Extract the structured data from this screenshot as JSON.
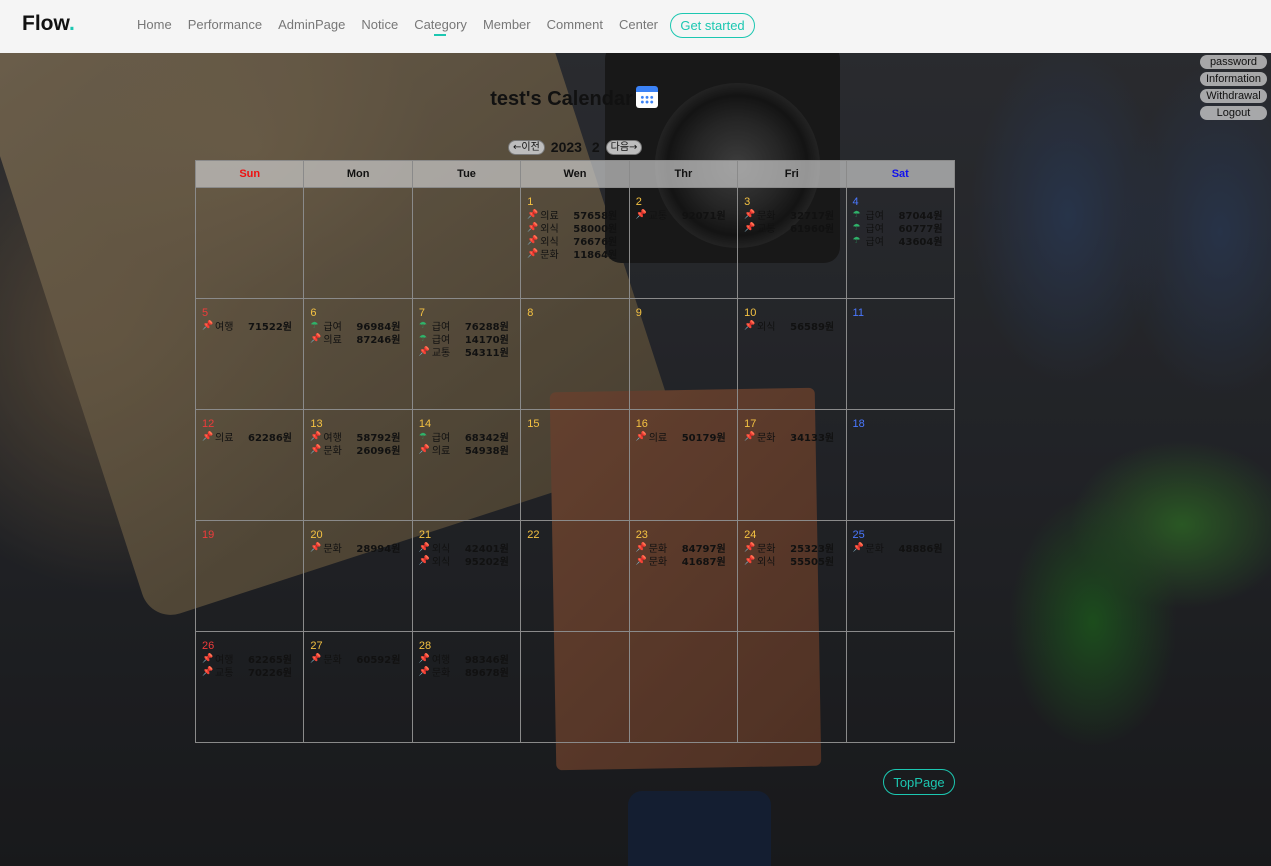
{
  "nav": {
    "logo": "Flow",
    "logo_dot": ".",
    "links": [
      "Home",
      "Performance",
      "AdminPage",
      "Notice",
      "Category",
      "Member",
      "Comment",
      "Center"
    ],
    "active": "Category",
    "cta": "Get started"
  },
  "user_menu": [
    "password",
    "Information",
    "Withdrawal",
    "Logout"
  ],
  "calendar": {
    "title": "test's Calendar",
    "prev_label": "←이전",
    "next_label": "다음→",
    "year": "2023",
    "month": "2",
    "weekdays": [
      "Sun",
      "Mon",
      "Tue",
      "Wen",
      "Thr",
      "Fri",
      "Sat"
    ],
    "weeks": [
      [
        null,
        null,
        null,
        {
          "day": "1",
          "entries": [
            {
              "type": "expense",
              "cat": "의료",
              "amount": "57658원"
            },
            {
              "type": "expense",
              "cat": "외식",
              "amount": "58000원"
            },
            {
              "type": "expense",
              "cat": "외식",
              "amount": "76676원"
            },
            {
              "type": "expense",
              "cat": "문화",
              "amount": "11864원"
            }
          ]
        },
        {
          "day": "2",
          "entries": [
            {
              "type": "expense",
              "cat": "교통",
              "amount": "92071원"
            }
          ]
        },
        {
          "day": "3",
          "entries": [
            {
              "type": "expense",
              "cat": "문화",
              "amount": "32717원"
            },
            {
              "type": "expense",
              "cat": "교통",
              "amount": "61960원"
            }
          ]
        },
        {
          "day": "4",
          "entries": [
            {
              "type": "income",
              "cat": "급여",
              "amount": "87044원"
            },
            {
              "type": "income",
              "cat": "급여",
              "amount": "60777원"
            },
            {
              "type": "income",
              "cat": "급여",
              "amount": "43604원"
            }
          ]
        }
      ],
      [
        {
          "day": "5",
          "entries": [
            {
              "type": "expense",
              "cat": "여행",
              "amount": "71522원"
            }
          ]
        },
        {
          "day": "6",
          "entries": [
            {
              "type": "income",
              "cat": "급여",
              "amount": "96984원"
            },
            {
              "type": "expense",
              "cat": "의료",
              "amount": "87246원"
            }
          ]
        },
        {
          "day": "7",
          "entries": [
            {
              "type": "income",
              "cat": "급여",
              "amount": "76288원"
            },
            {
              "type": "income",
              "cat": "급여",
              "amount": "14170원"
            },
            {
              "type": "expense",
              "cat": "교통",
              "amount": "54311원"
            }
          ]
        },
        {
          "day": "8",
          "entries": []
        },
        {
          "day": "9",
          "entries": []
        },
        {
          "day": "10",
          "entries": [
            {
              "type": "expense",
              "cat": "외식",
              "amount": "56589원"
            }
          ]
        },
        {
          "day": "11",
          "entries": []
        }
      ],
      [
        {
          "day": "12",
          "entries": [
            {
              "type": "expense",
              "cat": "의료",
              "amount": "62286원"
            }
          ]
        },
        {
          "day": "13",
          "entries": [
            {
              "type": "expense",
              "cat": "여행",
              "amount": "58792원"
            },
            {
              "type": "expense",
              "cat": "문화",
              "amount": "26096원"
            }
          ]
        },
        {
          "day": "14",
          "entries": [
            {
              "type": "income",
              "cat": "급여",
              "amount": "68342원"
            },
            {
              "type": "expense",
              "cat": "의료",
              "amount": "54938원"
            }
          ]
        },
        {
          "day": "15",
          "entries": []
        },
        {
          "day": "16",
          "entries": [
            {
              "type": "expense",
              "cat": "의료",
              "amount": "50179원"
            }
          ]
        },
        {
          "day": "17",
          "entries": [
            {
              "type": "expense",
              "cat": "문화",
              "amount": "34133원"
            }
          ]
        },
        {
          "day": "18",
          "entries": []
        }
      ],
      [
        {
          "day": "19",
          "entries": []
        },
        {
          "day": "20",
          "entries": [
            {
              "type": "expense",
              "cat": "문화",
              "amount": "28994원"
            }
          ]
        },
        {
          "day": "21",
          "entries": [
            {
              "type": "expense",
              "cat": "외식",
              "amount": "42401원"
            },
            {
              "type": "expense",
              "cat": "외식",
              "amount": "95202원"
            }
          ]
        },
        {
          "day": "22",
          "entries": []
        },
        {
          "day": "23",
          "entries": [
            {
              "type": "expense",
              "cat": "문화",
              "amount": "84797원"
            },
            {
              "type": "expense",
              "cat": "문화",
              "amount": "41687원"
            }
          ]
        },
        {
          "day": "24",
          "entries": [
            {
              "type": "expense",
              "cat": "문화",
              "amount": "25323원"
            },
            {
              "type": "expense",
              "cat": "외식",
              "amount": "55505원"
            }
          ]
        },
        {
          "day": "25",
          "entries": [
            {
              "type": "expense",
              "cat": "문화",
              "amount": "48886원"
            }
          ]
        }
      ],
      [
        {
          "day": "26",
          "entries": [
            {
              "type": "expense",
              "cat": "여행",
              "amount": "62265원"
            },
            {
              "type": "expense",
              "cat": "교통",
              "amount": "70226원"
            }
          ]
        },
        {
          "day": "27",
          "entries": [
            {
              "type": "expense",
              "cat": "문화",
              "amount": "60592원"
            }
          ]
        },
        {
          "day": "28",
          "entries": [
            {
              "type": "expense",
              "cat": "여행",
              "amount": "98346원"
            },
            {
              "type": "expense",
              "cat": "문화",
              "amount": "89678원"
            }
          ]
        },
        null,
        null,
        null,
        null
      ]
    ]
  },
  "toppage": "TopPage",
  "colors": {
    "accent": "#1cc7b1",
    "sunday": "#ef3b3b",
    "saturday": "#4a78ff",
    "weekday_num": "#f5c242"
  },
  "icons": {
    "expense": "pushpin-icon",
    "income": "umbrella-icon"
  }
}
